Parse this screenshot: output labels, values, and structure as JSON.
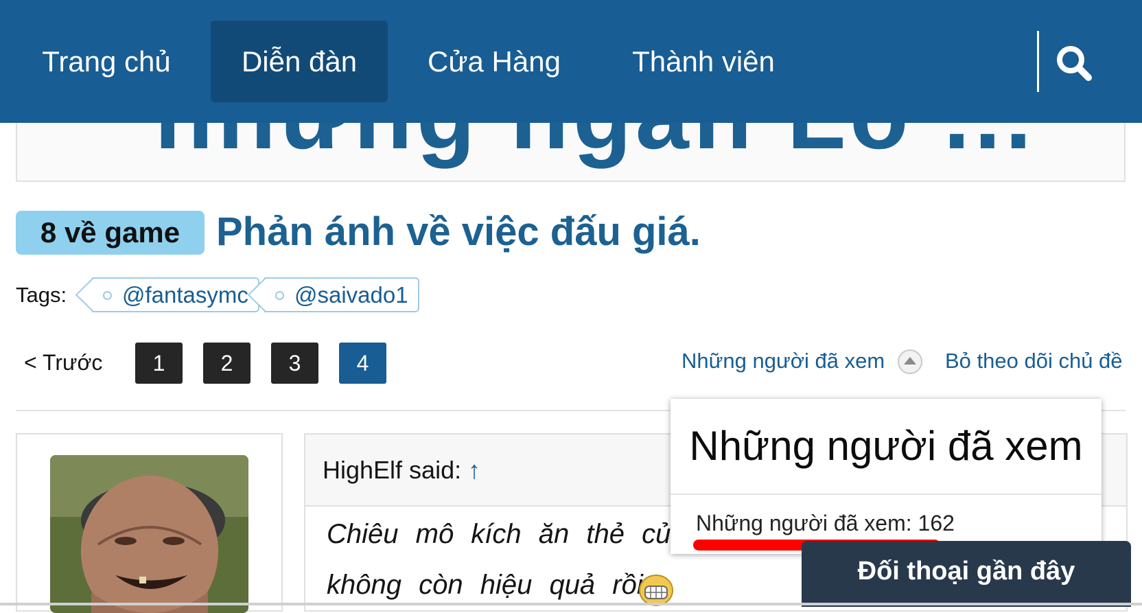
{
  "nav": {
    "items": [
      {
        "label": "Trang chủ"
      },
      {
        "label": "Diễn đàn"
      },
      {
        "label": "Cửa Hàng"
      },
      {
        "label": "Thành viên"
      }
    ],
    "active_index": 1,
    "search_icon": "search-icon"
  },
  "banner": {
    "partial_text": "nhưng ngân Lo ..."
  },
  "thread": {
    "prefix": "8 về game",
    "title": "Phản ánh về việc đấu giá."
  },
  "tags": {
    "label": "Tags:",
    "items": [
      "@fantasymc",
      "@saivado1"
    ]
  },
  "pagination": {
    "prev_label": "< Trước",
    "pages": [
      "1",
      "2",
      "3",
      "4"
    ],
    "current": "4"
  },
  "thread_actions": {
    "viewers_label": "Những người đã xem",
    "unwatch_label": "Bỏ theo dõi chủ đề"
  },
  "post": {
    "quote_author": "HighElf said:",
    "quote_arrow": "↑",
    "quote_lines": [
      "Chiêu mô kích ăn thẻ của bọn ở",
      "không còn hiệu quả rồi"
    ]
  },
  "viewers_popup": {
    "title": "Những người đã xem",
    "count_text": "Những người đã xem: 162",
    "annotation_color": "#ff0000"
  },
  "chat_bar": {
    "label": "Đối thoại gần đây"
  },
  "colors": {
    "nav_bg": "#185d93",
    "nav_active": "#124a77",
    "link": "#185d93",
    "prefix_bg": "#8fd0ee",
    "page_dark": "#262626",
    "chat_bg": "#28394c"
  }
}
